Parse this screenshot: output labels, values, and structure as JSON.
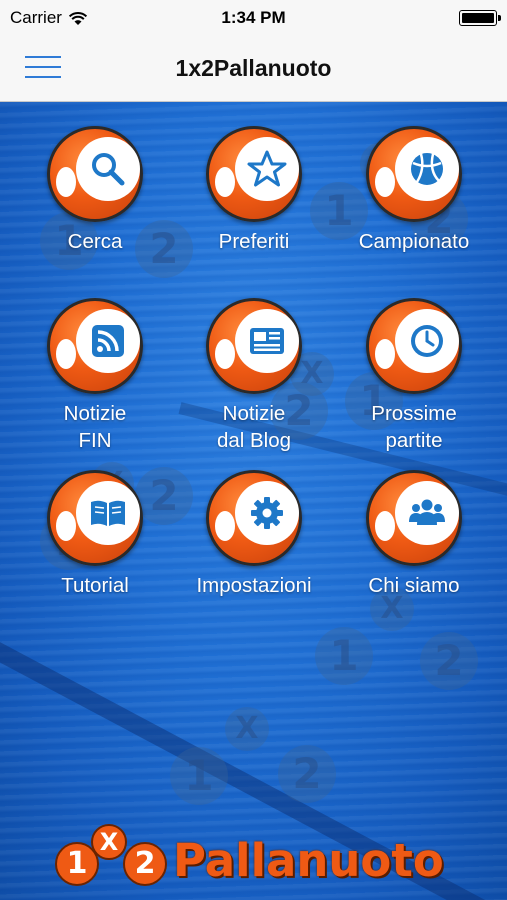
{
  "status_bar": {
    "carrier": "Carrier",
    "time": "1:34 PM"
  },
  "nav": {
    "title": "1x2Pallanuoto"
  },
  "menu": [
    {
      "label": "Cerca",
      "icon": "search-icon"
    },
    {
      "label": "Preferiti",
      "icon": "star-icon"
    },
    {
      "label": "Campionato",
      "icon": "ball-icon"
    },
    {
      "label": "Notizie\nFIN",
      "icon": "rss-icon"
    },
    {
      "label": "Notizie\ndal Blog",
      "icon": "newspaper-icon"
    },
    {
      "label": "Prossime\npartite",
      "icon": "clock-icon"
    },
    {
      "label": "Tutorial",
      "icon": "book-icon"
    },
    {
      "label": "Impostazioni",
      "icon": "gear-icon"
    },
    {
      "label": "Chi siamo",
      "icon": "people-icon"
    }
  ],
  "logo": {
    "one": "1",
    "x": "X",
    "two": "2",
    "word": "Pallanuoto"
  },
  "watermark": {
    "one": "1",
    "x": "X",
    "two": "2"
  },
  "colors": {
    "accent": "#2f7bd6",
    "orange": "#ef5a14",
    "icon_blue": "#1e78c8",
    "background_blue": "#1f6fd4"
  }
}
